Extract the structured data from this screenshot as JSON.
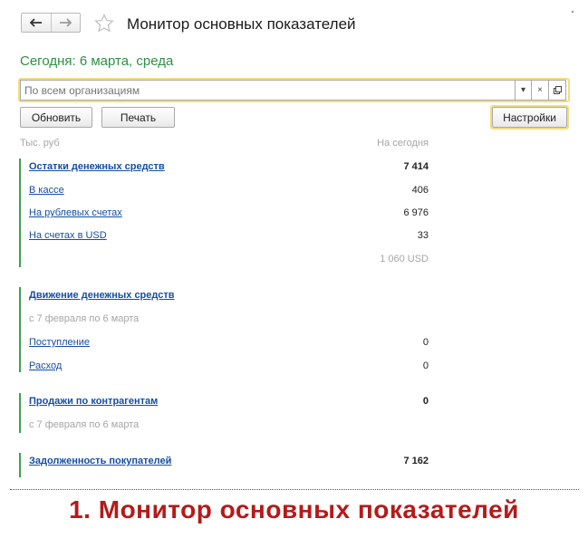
{
  "header": {
    "back_icon": "arrow-left-icon",
    "forward_icon": "arrow-right-icon",
    "favorite_icon": "star-icon",
    "title": "Монитор основных показателей"
  },
  "today_label": "Сегодня: 6 марта, среда",
  "organization": {
    "placeholder": "По всем организациям",
    "dropdown_glyph": "▾",
    "clear_glyph": "×"
  },
  "toolbar": {
    "refresh_label": "Обновить",
    "print_label": "Печать",
    "settings_label": "Настройки"
  },
  "columns": {
    "unit": "Тыс. руб",
    "today": "На сегодня"
  },
  "groups": {
    "cash": {
      "title": "Остатки денежных средств",
      "total": "7 414",
      "rows": [
        {
          "label": "В кассе",
          "value": "406"
        },
        {
          "label": "На рублевых счетах",
          "value": "6 976"
        },
        {
          "label": "На счетах в USD",
          "value": "33"
        }
      ],
      "usd_total": "1 060 USD"
    },
    "movement": {
      "title": "Движение денежных средств",
      "period": "с 7 февраля по 6 марта",
      "rows": [
        {
          "label": "Поступление",
          "value": "0"
        },
        {
          "label": "Расход",
          "value": "0"
        }
      ]
    },
    "sales": {
      "title": "Продажи по контрагентам",
      "total": "0",
      "period": "с 7 февраля по 6 марта"
    },
    "debt": {
      "title": "Задолженность покупателей",
      "total": "7 162"
    }
  },
  "caption": "1. Монитор основных показателей",
  "colors": {
    "accent_green": "#3aa24e",
    "link_blue": "#164ea0",
    "highlight_yellow": "#f4dd7e",
    "caption_red": "#b51a1a"
  }
}
